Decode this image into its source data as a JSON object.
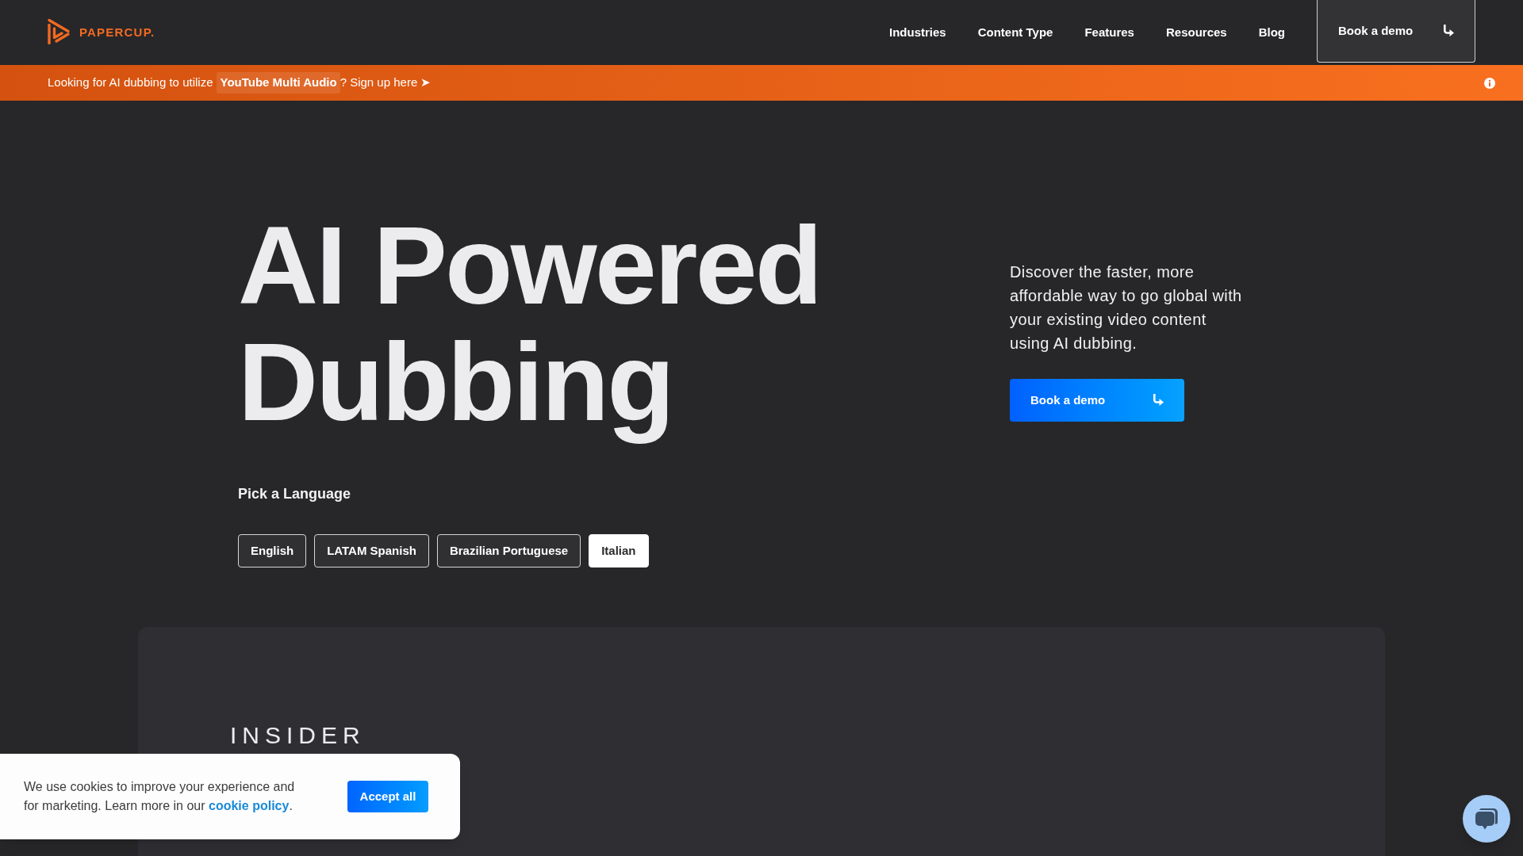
{
  "header": {
    "logo": "PAPERCUP.",
    "nav": [
      "Industries",
      "Content Type",
      "Features",
      "Resources",
      "Blog"
    ],
    "cta": "Book a demo"
  },
  "announcement": {
    "lead": "Looking for AI dubbing to utilize",
    "highlight": "YouTube Multi Audio",
    "link": "? Sign up here ➤"
  },
  "hero": {
    "title": "AI Powered Dubbing",
    "description": "Discover the faster, more affordable way to go global with your existing video content using AI dubbing.",
    "cta": "Book a demo",
    "language_picker": {
      "label": "Pick a Language",
      "options": [
        {
          "label": "English",
          "selected": false
        },
        {
          "label": "LATAM Spanish",
          "selected": false
        },
        {
          "label": "Brazilian Portuguese",
          "selected": false
        },
        {
          "label": "Italian",
          "selected": true
        }
      ]
    }
  },
  "media_card": {
    "logo": "INSIDER"
  },
  "cookie_banner": {
    "message": "We use cookies to improve your experience and for marketing. Learn more in our",
    "link": "cookie policy",
    "end": ".",
    "button": "Accept all"
  }
}
